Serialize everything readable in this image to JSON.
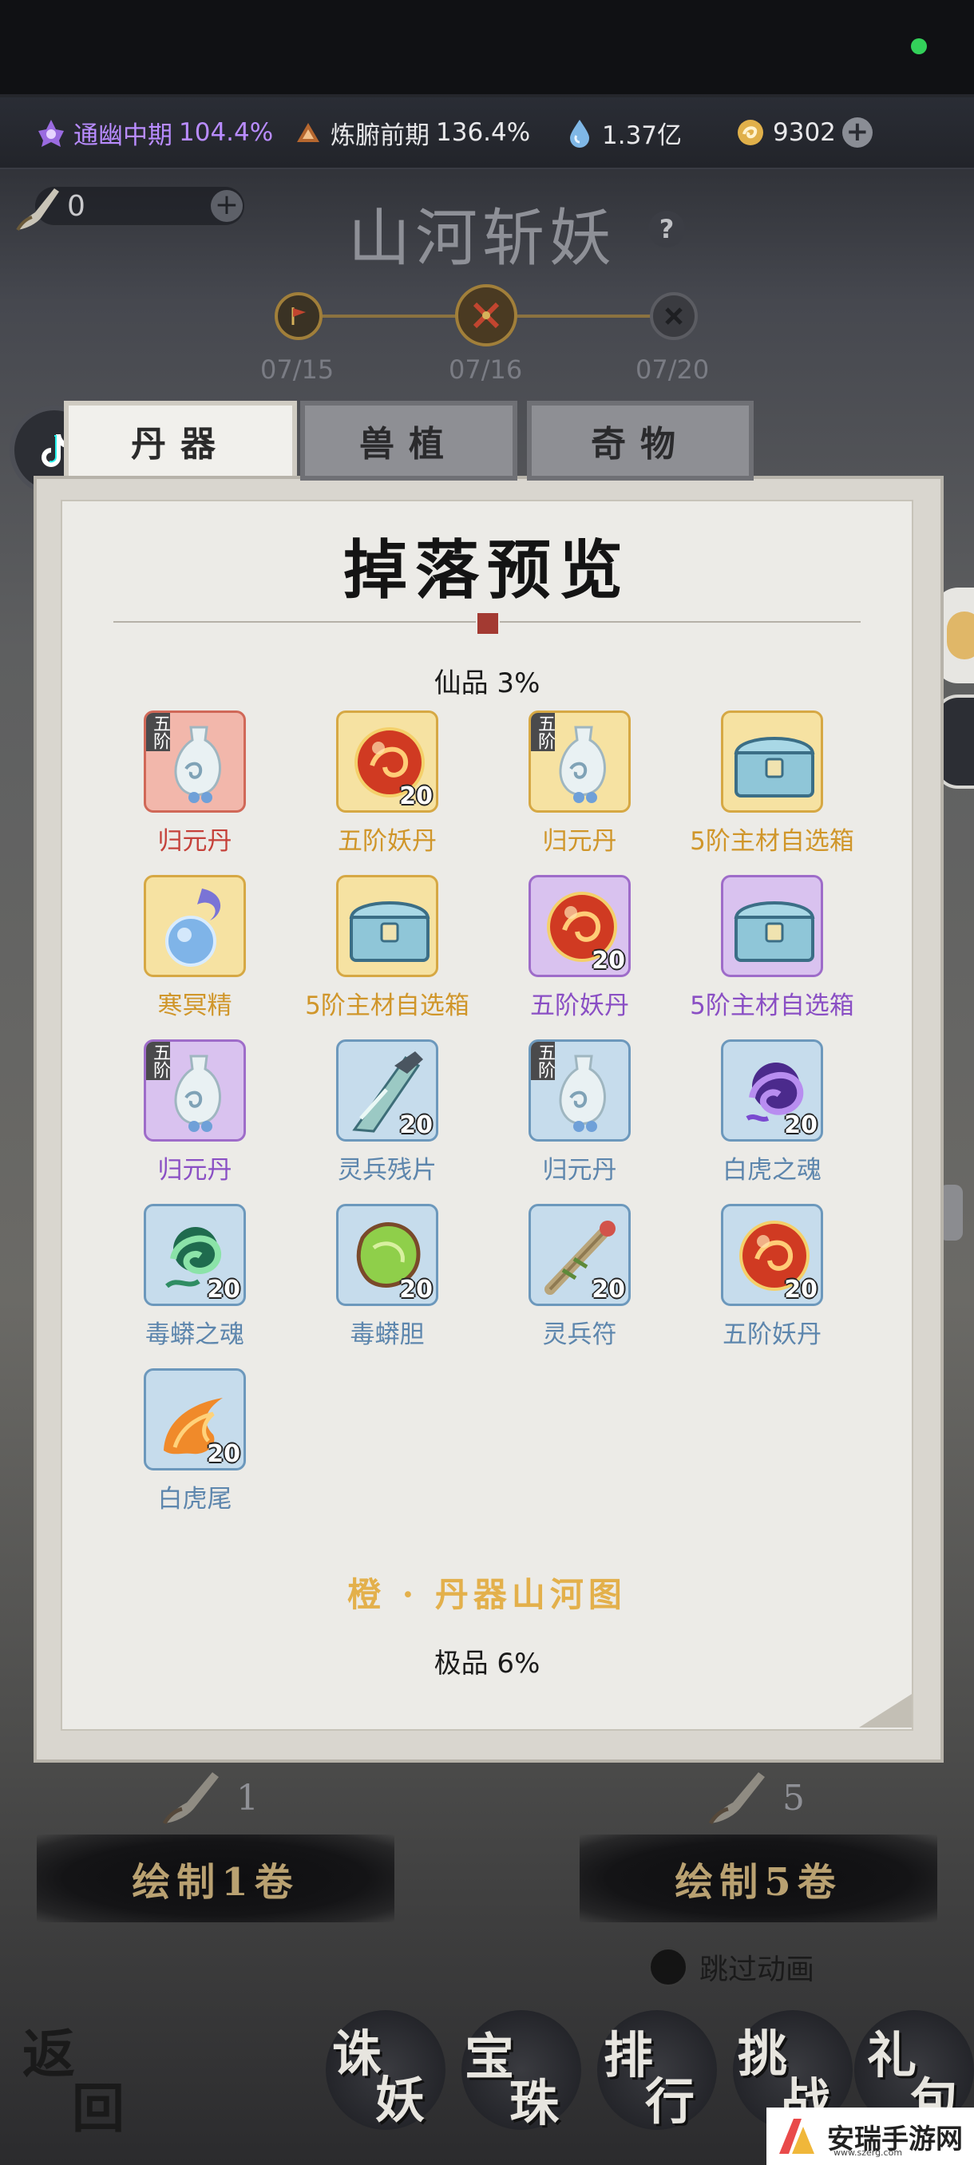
{
  "header": {
    "cultivation": {
      "label": "通幽中期",
      "value": "104.4%"
    },
    "body": {
      "label": "炼腑前期",
      "value": "136.4%"
    },
    "spirit_stones": "1.37亿",
    "coins": "9302"
  },
  "ticket_count": "0",
  "page_title": "山河斩妖",
  "help_symbol": "?",
  "timeline": [
    {
      "date": "07/15",
      "icon": "flag-icon"
    },
    {
      "date": "07/16",
      "icon": "crossed-swords-icon"
    },
    {
      "date": "07/20",
      "icon": "crossed-tools-icon"
    }
  ],
  "tabs": [
    {
      "label": "丹器",
      "active": true
    },
    {
      "label": "兽植",
      "active": false
    },
    {
      "label": "奇物",
      "active": false
    }
  ],
  "preview": {
    "title": "掉落预览",
    "tier1_label": "仙品 3%",
    "items": [
      {
        "name": "归元丹",
        "rarity": "red",
        "tier": "五阶",
        "count": "",
        "icon": "vase-icon"
      },
      {
        "name": "五阶妖丹",
        "rarity": "gold",
        "tier": "",
        "count": "20",
        "icon": "demon-core-icon"
      },
      {
        "name": "归元丹",
        "rarity": "gold",
        "tier": "五阶",
        "count": "",
        "icon": "vase-icon"
      },
      {
        "name": "5阶主材自选箱",
        "rarity": "gold",
        "tier": "",
        "count": "",
        "icon": "chest-icon"
      },
      {
        "name": "寒冥精",
        "rarity": "gold",
        "tier": "",
        "count": "",
        "icon": "spirit-orb-icon"
      },
      {
        "name": "5阶主材自选箱",
        "rarity": "gold",
        "tier": "",
        "count": "",
        "icon": "chest-icon"
      },
      {
        "name": "五阶妖丹",
        "rarity": "purple",
        "tier": "",
        "count": "20",
        "icon": "demon-core-icon"
      },
      {
        "name": "5阶主材自选箱",
        "rarity": "purple",
        "tier": "",
        "count": "",
        "icon": "chest-icon"
      },
      {
        "name": "归元丹",
        "rarity": "purple",
        "tier": "五阶",
        "count": "",
        "icon": "vase-icon"
      },
      {
        "name": "灵兵残片",
        "rarity": "blue",
        "tier": "",
        "count": "20",
        "icon": "blade-shard-icon"
      },
      {
        "name": "归元丹",
        "rarity": "blue",
        "tier": "五阶",
        "count": "",
        "icon": "vase-icon"
      },
      {
        "name": "白虎之魂",
        "rarity": "blue",
        "tier": "",
        "count": "20",
        "icon": "purple-soul-icon"
      },
      {
        "name": "毒蟒之魂",
        "rarity": "blue",
        "tier": "",
        "count": "20",
        "icon": "green-soul-icon"
      },
      {
        "name": "毒蟒胆",
        "rarity": "blue",
        "tier": "",
        "count": "20",
        "icon": "gallbladder-icon"
      },
      {
        "name": "灵兵符",
        "rarity": "blue",
        "tier": "",
        "count": "20",
        "icon": "talisman-icon"
      },
      {
        "name": "五阶妖丹",
        "rarity": "blue",
        "tier": "",
        "count": "20",
        "icon": "demon-core-icon"
      },
      {
        "name": "白虎尾",
        "rarity": "blue",
        "tier": "",
        "count": "20",
        "icon": "flame-tail-icon"
      }
    ],
    "map_title": "橙 · 丹器山河图",
    "tier2_label": "极品 6%"
  },
  "draw": {
    "single": {
      "cost": "1",
      "label": "绘制1卷"
    },
    "multi": {
      "cost": "5",
      "label": "绘制5卷"
    },
    "skip_label": "跳过动画"
  },
  "nav": {
    "back": [
      "返",
      "回"
    ],
    "items": [
      [
        "诛",
        "妖"
      ],
      [
        "宝",
        "珠"
      ],
      [
        "排",
        "行"
      ],
      [
        "挑",
        "战"
      ],
      [
        "礼",
        "包"
      ]
    ]
  },
  "watermark": {
    "text": "安瑞手游网",
    "url": "www.szerg.com"
  },
  "colors": {
    "red": "#c5413a",
    "gold": "#d0962a",
    "purple": "#8a4fc4",
    "blue": "#5d86ad",
    "map_title": "#e3b04b"
  }
}
